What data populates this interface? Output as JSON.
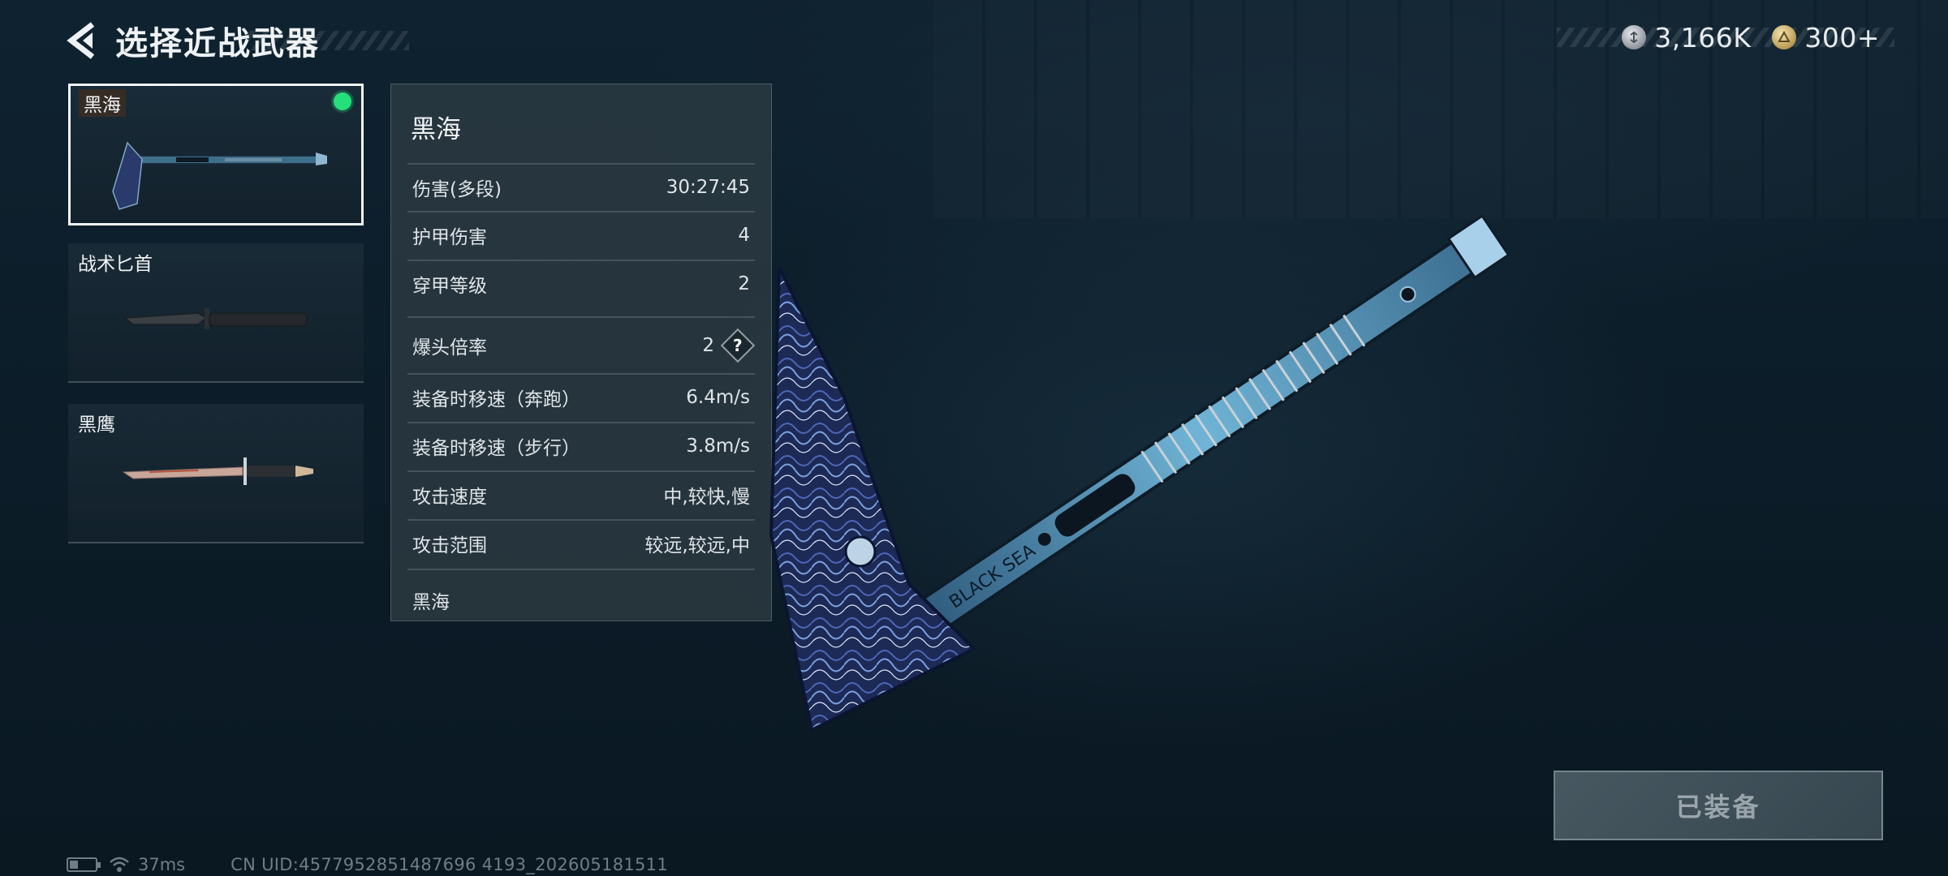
{
  "header": {
    "back_icon": "chevron-left-icon",
    "title": "选择近战武器"
  },
  "currency": {
    "silver_icon": "silver-coin-icon",
    "silver_value": "3,166K",
    "gold_icon": "gold-coin-icon",
    "gold_value": "300+"
  },
  "weapons": [
    {
      "name": "黑海",
      "selected": true,
      "equipped": true,
      "icon": "tactical-axe-icon"
    },
    {
      "name": "战术匕首",
      "selected": false,
      "equipped": false,
      "icon": "combat-knife-icon"
    },
    {
      "name": "黑鹰",
      "selected": false,
      "equipped": false,
      "icon": "dagger-icon"
    }
  ],
  "stats": {
    "title": "黑海",
    "rows": [
      {
        "label": "伤害(多段)",
        "value": "30:27:45"
      },
      {
        "label": "护甲伤害",
        "value": "4"
      },
      {
        "label": "穿甲等级",
        "value": "2"
      },
      {
        "label": "爆头倍率",
        "value": "2",
        "help": "?"
      },
      {
        "label": "装备时移速（奔跑）",
        "value": "6.4m/s"
      },
      {
        "label": "装备时移速（步行）",
        "value": "3.8m/s"
      },
      {
        "label": "攻击速度",
        "value": "中,较快,慢"
      },
      {
        "label": "攻击范围",
        "value": "较远,较远,中"
      }
    ],
    "description": "黑海"
  },
  "preview": {
    "engraving": "BLACK SEA",
    "accent": "#6fb4d6",
    "blade_dark": "#1c2a55"
  },
  "action": {
    "equipped_label": "已装备"
  },
  "status_bar": {
    "battery_icon": "battery-icon",
    "wifi_icon": "wifi-icon",
    "ping": "37ms",
    "uid": "CN UID:4577952851487696 4193_202605181511"
  },
  "colors": {
    "equipped_dot": "#25e07a",
    "background": "#0c1d29"
  }
}
